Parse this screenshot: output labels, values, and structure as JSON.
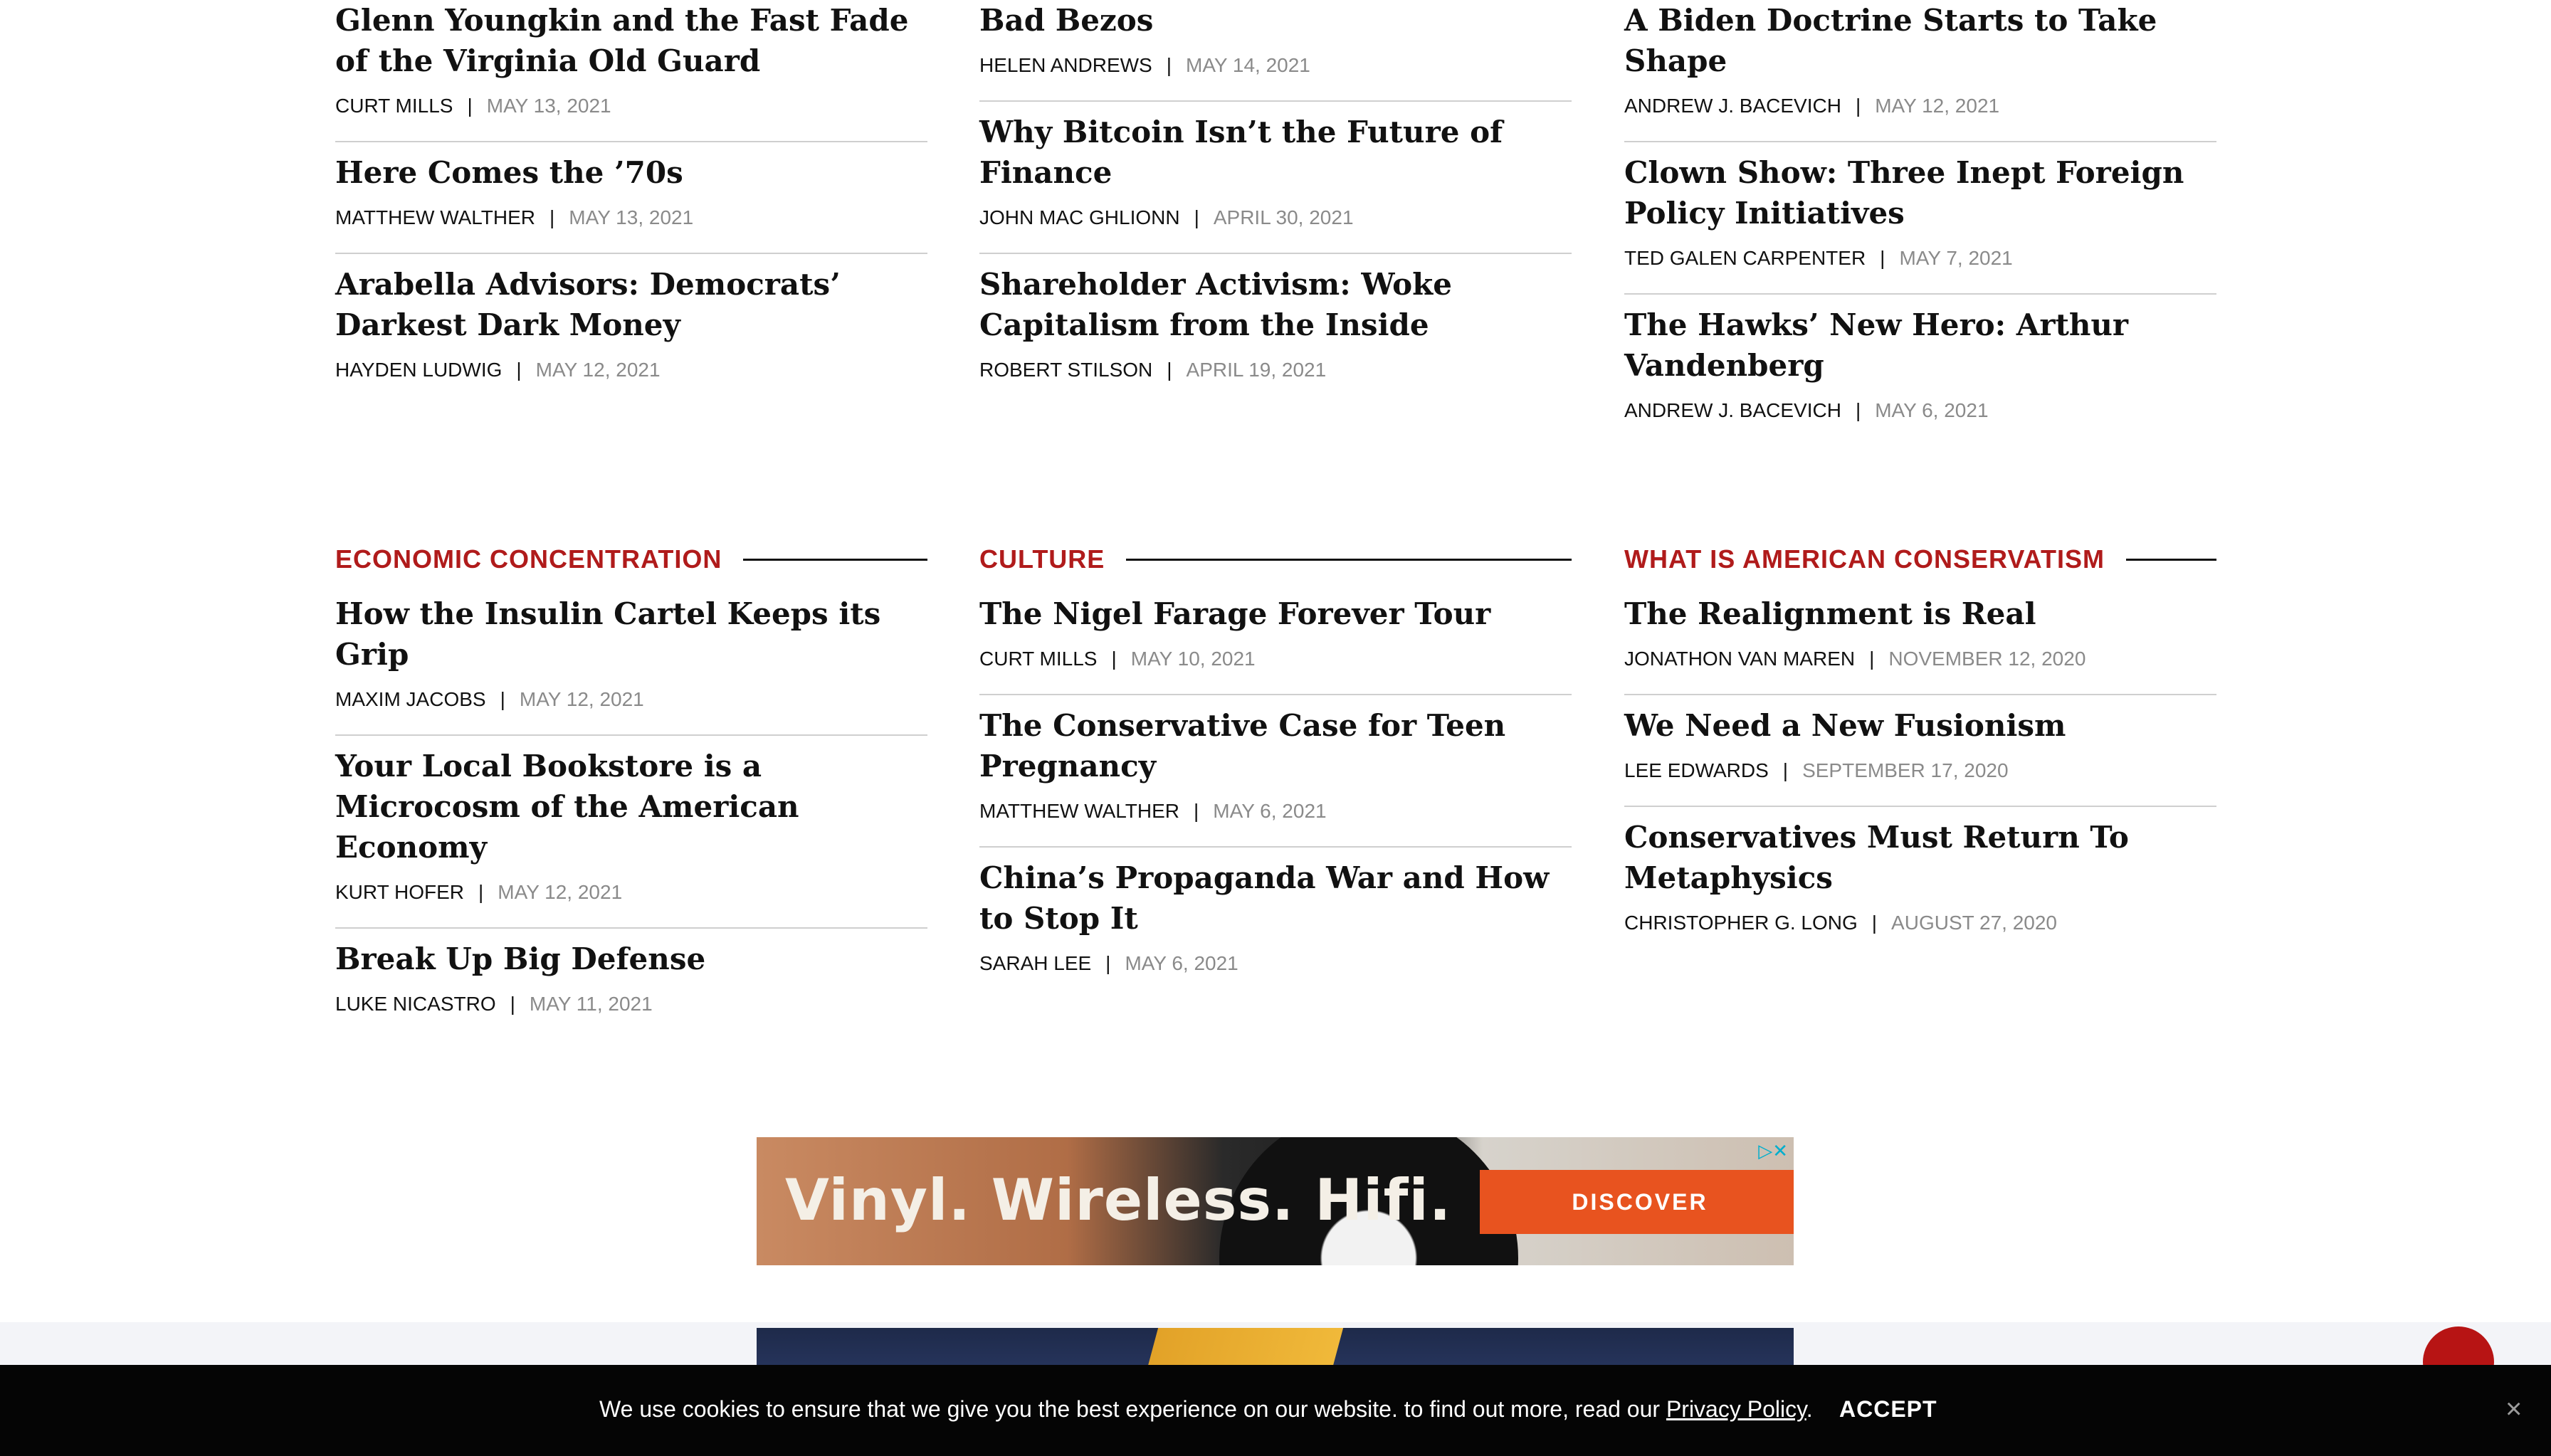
{
  "columns_top": [
    {
      "articles": [
        {
          "title": "Glenn Youngkin and the Fast Fade of the Virginia Old Guard",
          "author": "CURT MILLS",
          "date": "MAY 13, 2021"
        },
        {
          "title": "Here Comes the ’70s",
          "author": "MATTHEW WALTHER",
          "date": "MAY 13, 2021"
        },
        {
          "title": "Arabella Advisors: Democrats’ Darkest Dark Money",
          "author": "HAYDEN LUDWIG",
          "date": "MAY 12, 2021"
        }
      ]
    },
    {
      "articles": [
        {
          "title": "Bad Bezos",
          "author": "HELEN ANDREWS",
          "date": "MAY 14, 2021"
        },
        {
          "title": "Why Bitcoin Isn’t the Future of Finance",
          "author": "JOHN MAC GHLIONN",
          "date": "APRIL 30, 2021"
        },
        {
          "title": "Shareholder Activism: Woke Capitalism from the Inside",
          "author": "ROBERT STILSON",
          "date": "APRIL 19, 2021"
        }
      ]
    },
    {
      "articles": [
        {
          "title": "A Biden Doctrine Starts to Take Shape",
          "author": "ANDREW J. BACEVICH",
          "date": "MAY 12, 2021"
        },
        {
          "title": "Clown Show: Three Inept Foreign Policy Initiatives",
          "author": "TED GALEN CARPENTER",
          "date": "MAY 7, 2021"
        },
        {
          "title": "The Hawks’ New Hero: Arthur Vandenberg",
          "author": "ANDREW J. BACEVICH",
          "date": "MAY 6, 2021"
        }
      ]
    }
  ],
  "columns_bottom": [
    {
      "section": "ECONOMIC CONCENTRATION",
      "articles": [
        {
          "title": "How the Insulin Cartel Keeps its Grip",
          "author": "MAXIM JACOBS",
          "date": "MAY 12, 2021"
        },
        {
          "title": "Your Local Bookstore is a Microcosm of the American Economy",
          "author": "KURT HOFER",
          "date": "MAY 12, 2021"
        },
        {
          "title": "Break Up Big Defense",
          "author": "LUKE NICASTRO",
          "date": "MAY 11, 2021"
        }
      ]
    },
    {
      "section": "CULTURE",
      "articles": [
        {
          "title": "The Nigel Farage Forever Tour",
          "author": "CURT MILLS",
          "date": "MAY 10, 2021"
        },
        {
          "title": "The Conservative Case for Teen Pregnancy",
          "author": "MATTHEW WALTHER",
          "date": "MAY 6, 2021"
        },
        {
          "title": "China’s Propaganda War and How to Stop It",
          "author": "SARAH LEE",
          "date": "MAY 6, 2021"
        }
      ]
    },
    {
      "section": "WHAT IS AMERICAN CONSERVATISM",
      "articles": [
        {
          "title": "The Realignment is Real",
          "author": "JONATHON VAN MAREN",
          "date": "NOVEMBER 12, 2020"
        },
        {
          "title": "We Need a New Fusionism",
          "author": "LEE EDWARDS",
          "date": "SEPTEMBER 17, 2020"
        },
        {
          "title": "Conservatives Must Return To Metaphysics",
          "author": "CHRISTOPHER G. LONG",
          "date": "AUGUST 27, 2020"
        }
      ]
    }
  ],
  "ad": {
    "headline": "Vinyl. Wireless. Hifi.",
    "cta": "DISCOVER",
    "choices_icon": "ad-choices-icon"
  },
  "cookie": {
    "text": "We use cookies to ensure that we give you the best experience on our website. to find out more, read our ",
    "link": "Privacy Policy",
    "after": ".",
    "accept": "ACCEPT",
    "close": "×"
  },
  "colors": {
    "accent": "#b01b1b",
    "cta": "#e8531f",
    "cookie_bg": "#050505"
  }
}
